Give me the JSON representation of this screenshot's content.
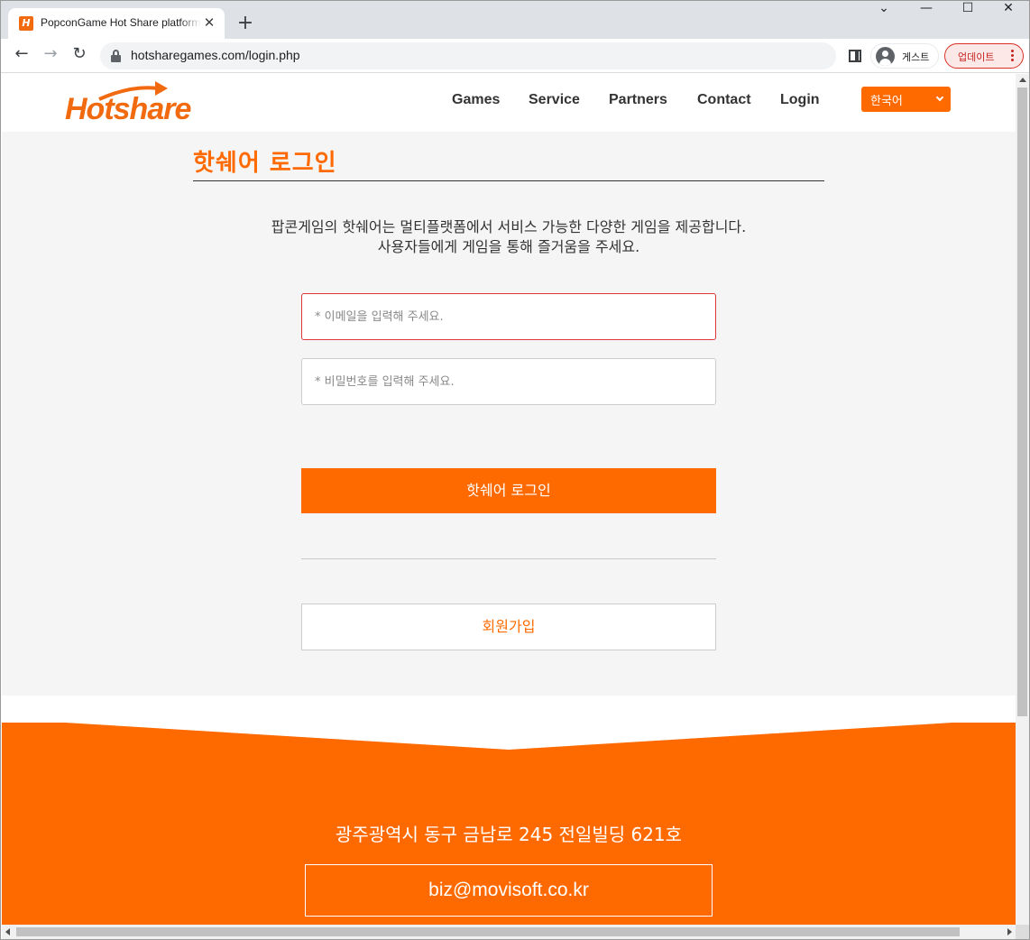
{
  "browser": {
    "tab_title": "PopconGame Hot Share platform",
    "favicon_letter": "H",
    "url": "hotsharegames.com/login.php",
    "profile_label": "게스트",
    "update_label": "업데이트"
  },
  "site": {
    "logo_text": "Hotshare",
    "brand_color": "#ff6a00",
    "nav": {
      "games": "Games",
      "service": "Service",
      "partners": "Partners",
      "contact": "Contact",
      "login": "Login"
    },
    "language": "한국어"
  },
  "login": {
    "title": "핫쉐어 로그인",
    "intro_line1": "팝콘게임의 핫쉐어는 멀티플랫폼에서 서비스 가능한 다양한 게임을 제공합니다.",
    "intro_line2": "사용자들에게 게임을 통해 즐거움을 주세요.",
    "email_placeholder": "* 이메일을 입력해 주세요.",
    "password_placeholder": "* 비밀번호를 입력해 주세요.",
    "submit_label": "핫쉐어 로그인",
    "signup_label": "회원가입"
  },
  "footer": {
    "address": "광주광역시 동구 금남로 245 전일빌딩 621호",
    "email": "biz@movisoft.co.kr"
  }
}
